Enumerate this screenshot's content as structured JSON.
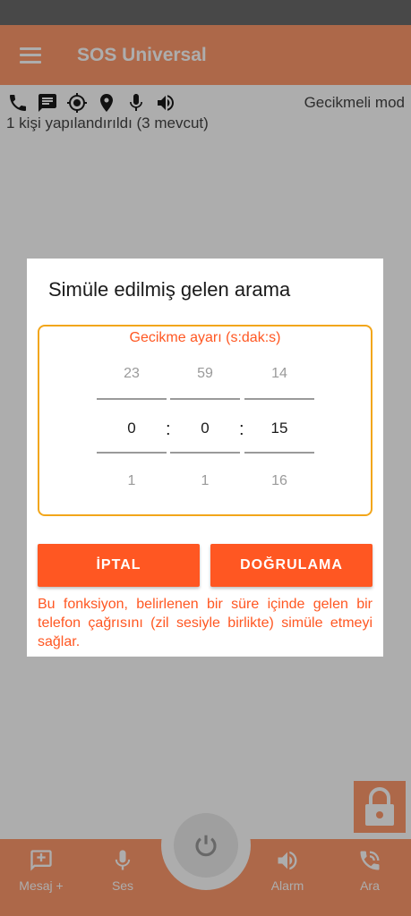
{
  "app": {
    "title": "SOS Universal",
    "accent_color": "#ff9a6c"
  },
  "info": {
    "icons": [
      "phone-icon",
      "message-icon",
      "gps-icon",
      "location-pin-icon",
      "microphone-icon",
      "speaker-icon"
    ],
    "mode_label": "Gecikmeli mod",
    "contacts_text": "1 kişi yapılandırıldı (3 mevcut)"
  },
  "dialog": {
    "title": "Simüle edilmiş gelen arama",
    "picker_label": "Gecikme ayarı (s:dak:s)",
    "hours": {
      "prev": "23",
      "current": "0",
      "next": "1"
    },
    "minutes": {
      "prev": "59",
      "current": "0",
      "next": "1"
    },
    "seconds": {
      "prev": "14",
      "current": "15",
      "next": "16"
    },
    "separator": ":",
    "cancel_label": "İPTAL",
    "confirm_label": "DOĞRULAMA",
    "help_text": "Bu fonksiyon, belirlenen bir süre içinde gelen bir telefon çağrısını (zil sesiyle birlikte) simüle etmeyi sağlar.",
    "button_color": "#ff5722",
    "border_color": "#f2a61a"
  },
  "bottom_nav": {
    "items": [
      {
        "label": "Mesaj +",
        "icon": "add-message-icon"
      },
      {
        "label": "Ses",
        "icon": "microphone-icon"
      },
      {
        "label": "Alarm",
        "icon": "speaker-icon"
      },
      {
        "label": "Ara",
        "icon": "call-icon"
      }
    ]
  }
}
